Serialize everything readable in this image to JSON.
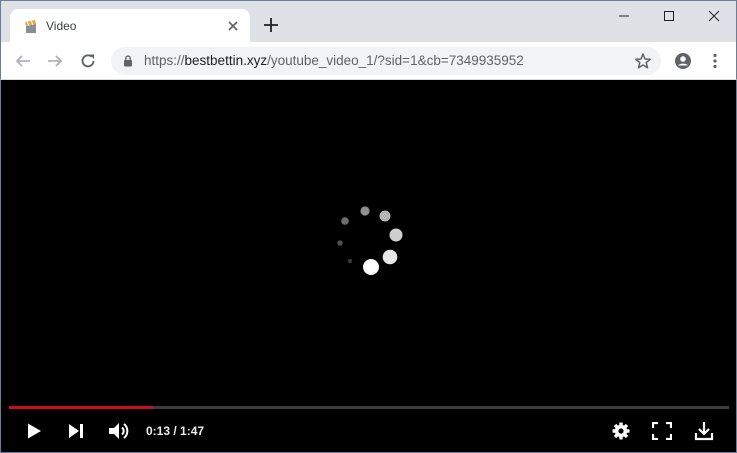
{
  "tab": {
    "title": "Video",
    "favicon": "video-favicon",
    "close_icon": "close-icon"
  },
  "new_tab_icon": "plus-icon",
  "window_controls": [
    "minimize-icon",
    "maximize-icon",
    "close-icon"
  ],
  "toolbar": {
    "back_icon": "arrow-left-icon",
    "forward_icon": "arrow-right-icon",
    "reload_icon": "reload-icon",
    "profile_icon": "account-icon",
    "menu_icon": "kebab-menu-icon"
  },
  "omnibox": {
    "url_scheme": "https://",
    "url_host": "bestbettin.xyz",
    "url_rest": "/youtube_video_1/?sid=1&cb=7349935952",
    "lock_icon": "lock-icon",
    "bookmark_icon": "star-icon"
  },
  "player": {
    "loading_icon": "loading-spinner-icon",
    "progress_fraction": 0.2,
    "timecode": "0:13 / 1:47",
    "play_icon": "play-icon",
    "next_icon": "skip-next-icon",
    "volume_icon": "volume-icon",
    "settings_icon": "gear-icon",
    "fullscreen_icon": "fullscreen-icon",
    "download_icon": "download-icon"
  },
  "colors": {
    "tab_strip": "#dee1e6",
    "progress_played": "#cc0f1f",
    "progress_track": "#3d3d3d",
    "background": "#000000"
  }
}
